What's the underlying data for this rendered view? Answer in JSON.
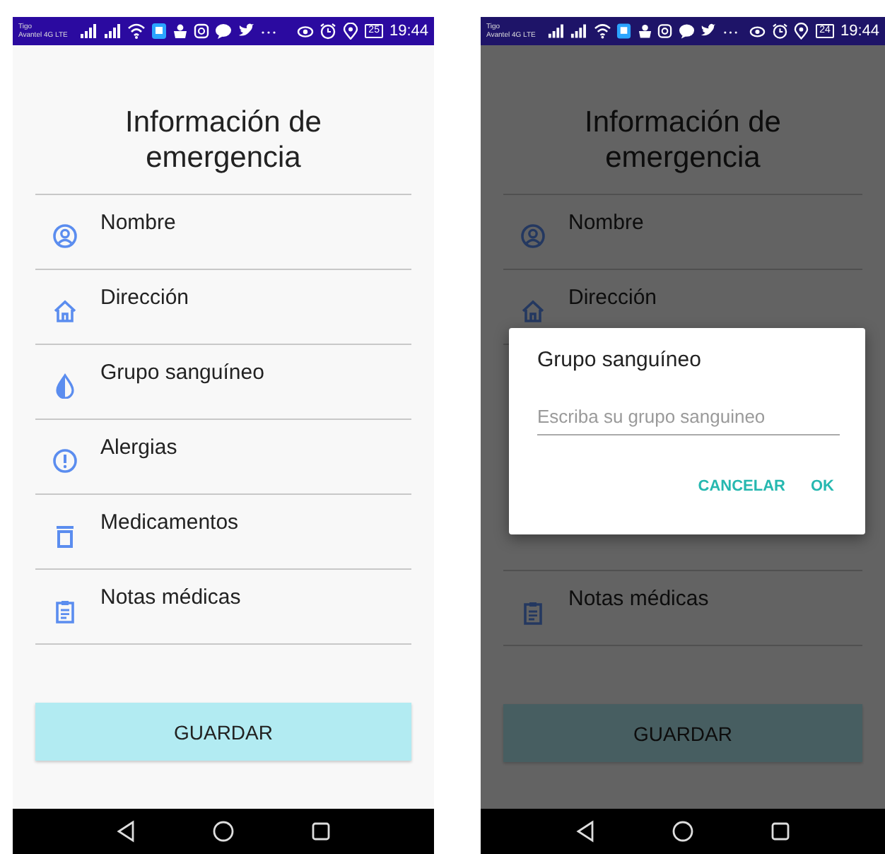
{
  "phones": [
    {
      "dimmed": false,
      "status_bar": {
        "carrier": "Tigo",
        "network": "Avantel 4G LTE",
        "battery": "25",
        "time": "19:44"
      },
      "screen": {
        "title": "Información de emergencia",
        "items": [
          {
            "kind": "person",
            "label": "Nombre"
          },
          {
            "kind": "home",
            "label": "Dirección"
          },
          {
            "kind": "drop",
            "label": "Grupo sanguíneo"
          },
          {
            "kind": "alert",
            "label": "Alergias"
          },
          {
            "kind": "bin",
            "label": "Medicamentos"
          },
          {
            "kind": "clipboard",
            "label": "Notas médicas"
          }
        ],
        "save_button": "GUARDAR"
      }
    },
    {
      "dimmed": true,
      "status_bar": {
        "carrier": "Tigo",
        "network": "Avantel 4G LTE",
        "battery": "24",
        "time": "19:44"
      },
      "screen": {
        "title": "Información de emergencia",
        "items": [
          {
            "kind": "person",
            "label": "Nombre"
          },
          {
            "kind": "home",
            "label": "Dirección"
          }
        ],
        "items_below": [
          {
            "kind": "clipboard",
            "label": "Notas médicas"
          }
        ],
        "save_button": "GUARDAR"
      },
      "dialog": {
        "title": "Grupo sanguíneo",
        "field": {
          "placeholder": "Escriba su grupo sanguineo"
        },
        "buttons": [
          "CANCELAR",
          "OK"
        ]
      }
    }
  ]
}
